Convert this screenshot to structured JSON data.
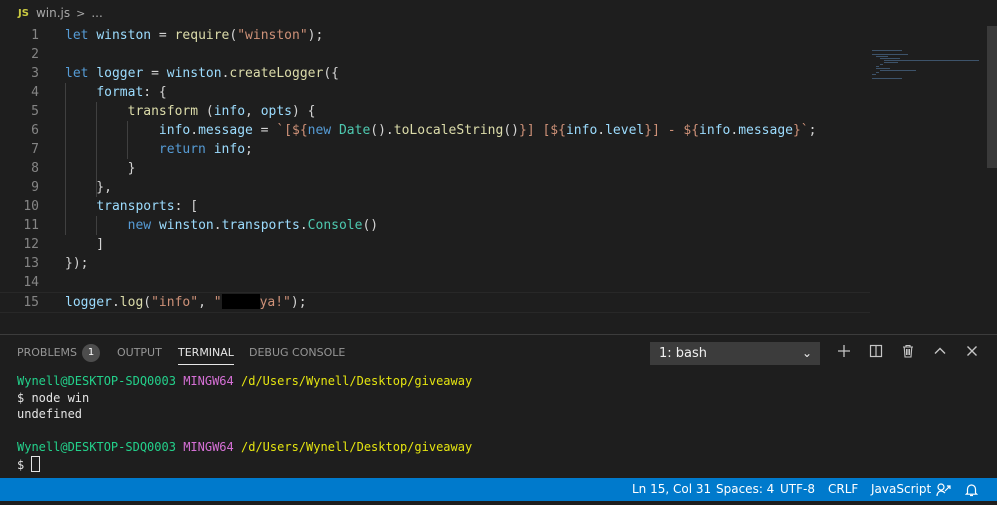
{
  "breadcrumb": {
    "file_icon": "JS",
    "file": "win.js",
    "separator": ">",
    "more": "..."
  },
  "editor": {
    "lines": [
      {
        "n": "1",
        "tokens": [
          [
            "kw",
            "let"
          ],
          [
            "pun",
            " "
          ],
          [
            "var",
            "winston"
          ],
          [
            "pun",
            " = "
          ],
          [
            "fn",
            "require"
          ],
          [
            "pun",
            "("
          ],
          [
            "str",
            "\"winston\""
          ],
          [
            "pun",
            ");"
          ]
        ]
      },
      {
        "n": "2",
        "tokens": []
      },
      {
        "n": "3",
        "tokens": [
          [
            "kw",
            "let"
          ],
          [
            "pun",
            " "
          ],
          [
            "var",
            "logger"
          ],
          [
            "pun",
            " = "
          ],
          [
            "var",
            "winston"
          ],
          [
            "pun",
            "."
          ],
          [
            "fn",
            "createLogger"
          ],
          [
            "pun",
            "({"
          ]
        ]
      },
      {
        "n": "4",
        "tokens": [
          [
            "pun",
            "    "
          ],
          [
            "var",
            "format"
          ],
          [
            "pun",
            ": {"
          ]
        ]
      },
      {
        "n": "5",
        "tokens": [
          [
            "pun",
            "        "
          ],
          [
            "fn",
            "transform"
          ],
          [
            "pun",
            " ("
          ],
          [
            "var",
            "info"
          ],
          [
            "pun",
            ", "
          ],
          [
            "var",
            "opts"
          ],
          [
            "pun",
            ") {"
          ]
        ]
      },
      {
        "n": "6",
        "tokens": [
          [
            "pun",
            "            "
          ],
          [
            "var",
            "info"
          ],
          [
            "pun",
            "."
          ],
          [
            "var",
            "message"
          ],
          [
            "pun",
            " = "
          ],
          [
            "str",
            "`[${"
          ],
          [
            "kw",
            "new"
          ],
          [
            "pun",
            " "
          ],
          [
            "cls",
            "Date"
          ],
          [
            "pun",
            "()."
          ],
          [
            "fn",
            "toLocaleString"
          ],
          [
            "pun",
            "()"
          ],
          [
            "str",
            "}] [${"
          ],
          [
            "var",
            "info"
          ],
          [
            "pun",
            "."
          ],
          [
            "var",
            "level"
          ],
          [
            "str",
            "}] - ${"
          ],
          [
            "var",
            "info"
          ],
          [
            "pun",
            "."
          ],
          [
            "var",
            "message"
          ],
          [
            "str",
            "}`"
          ],
          [
            "pun",
            ";"
          ]
        ]
      },
      {
        "n": "7",
        "tokens": [
          [
            "pun",
            "            "
          ],
          [
            "kw",
            "return"
          ],
          [
            "pun",
            " "
          ],
          [
            "var",
            "info"
          ],
          [
            "pun",
            ";"
          ]
        ]
      },
      {
        "n": "8",
        "tokens": [
          [
            "pun",
            "        }"
          ]
        ]
      },
      {
        "n": "9",
        "tokens": [
          [
            "pun",
            "    },"
          ]
        ]
      },
      {
        "n": "10",
        "tokens": [
          [
            "pun",
            "    "
          ],
          [
            "var",
            "transports"
          ],
          [
            "pun",
            ": ["
          ]
        ]
      },
      {
        "n": "11",
        "tokens": [
          [
            "pun",
            "        "
          ],
          [
            "kw",
            "new"
          ],
          [
            "pun",
            " "
          ],
          [
            "var",
            "winston"
          ],
          [
            "pun",
            "."
          ],
          [
            "var",
            "transports"
          ],
          [
            "pun",
            "."
          ],
          [
            "cls",
            "Console"
          ],
          [
            "pun",
            "()"
          ]
        ]
      },
      {
        "n": "12",
        "tokens": [
          [
            "pun",
            "    ]"
          ]
        ]
      },
      {
        "n": "13",
        "tokens": [
          [
            "pun",
            "});"
          ]
        ]
      },
      {
        "n": "14",
        "tokens": []
      },
      {
        "n": "15",
        "tokens": [
          [
            "var",
            "logger"
          ],
          [
            "pun",
            "."
          ],
          [
            "fn",
            "log"
          ],
          [
            "pun",
            "("
          ],
          [
            "str",
            "\"info\""
          ],
          [
            "pun",
            ", "
          ],
          [
            "str",
            "\""
          ],
          [
            "redact",
            ""
          ],
          [
            "str",
            "ya!\""
          ],
          [
            "pun",
            ");"
          ]
        ]
      }
    ]
  },
  "panel": {
    "tabs": [
      {
        "id": "problems",
        "label": "PROBLEMS",
        "badge": "1"
      },
      {
        "id": "output",
        "label": "OUTPUT"
      },
      {
        "id": "terminal",
        "label": "TERMINAL"
      },
      {
        "id": "debug",
        "label": "DEBUG CONSOLE"
      }
    ],
    "active_tab": "terminal",
    "terminal_select": "1: bash",
    "icons": [
      "plus-icon",
      "split-icon",
      "trash-icon",
      "chevron-up-icon",
      "close-icon"
    ]
  },
  "terminal": {
    "prompt_user": "Wynell@DESKTOP-SDQ0003",
    "prompt_env": "MINGW64",
    "prompt_path": "/d/Users/Wynell/Desktop/giveaway",
    "command": "$ node win",
    "output": "undefined",
    "prompt_symbol": "$"
  },
  "status": {
    "position": "Ln 15, Col 31",
    "spaces": "Spaces: 4",
    "encoding": "UTF-8",
    "eol": "CRLF",
    "language": "JavaScript"
  },
  "colors": {
    "accent": "#007acc",
    "background": "#1e1e1e"
  }
}
